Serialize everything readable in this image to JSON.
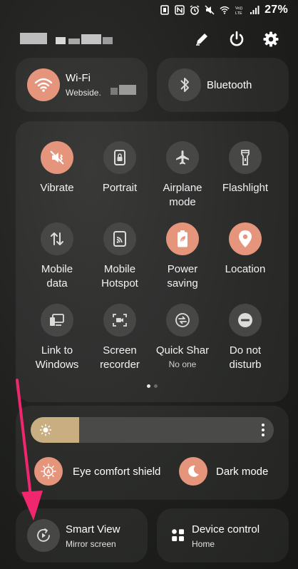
{
  "status": {
    "battery_pct": "27%",
    "network": "VoLTE LTE"
  },
  "header": {
    "icons": [
      "pencil-icon",
      "power-icon",
      "settings-gear-icon"
    ]
  },
  "wifi": {
    "title": "Wi-Fi",
    "subtitle": "Webside.",
    "state": "on"
  },
  "bluetooth": {
    "title": "Bluetooth",
    "state": "off"
  },
  "tiles": [
    {
      "label1": "Vibrate",
      "label2": "",
      "sub": "",
      "state": "on",
      "icon": "vibrate-icon"
    },
    {
      "label1": "Portrait",
      "label2": "",
      "sub": "",
      "state": "off",
      "icon": "portrait-lock-icon"
    },
    {
      "label1": "Airplane",
      "label2": "mode",
      "sub": "",
      "state": "off",
      "icon": "airplane-icon"
    },
    {
      "label1": "Flashlight",
      "label2": "",
      "sub": "",
      "state": "off",
      "icon": "flashlight-icon"
    },
    {
      "label1": "Mobile",
      "label2": "data",
      "sub": "",
      "state": "off",
      "icon": "mobile-data-icon"
    },
    {
      "label1": "Mobile",
      "label2": "Hotspot",
      "sub": "",
      "state": "off",
      "icon": "hotspot-icon"
    },
    {
      "label1": "Power",
      "label2": "saving",
      "sub": "",
      "state": "on",
      "icon": "power-saving-icon"
    },
    {
      "label1": "Location",
      "label2": "",
      "sub": "",
      "state": "on",
      "icon": "location-icon"
    },
    {
      "label1": "Link to",
      "label2": "Windows",
      "sub": "",
      "state": "off",
      "icon": "link-to-windows-icon"
    },
    {
      "label1": "Screen",
      "label2": "recorder",
      "sub": "",
      "state": "off",
      "icon": "screen-recorder-icon"
    },
    {
      "label1": "Quick Shar",
      "label2": "",
      "sub": "No one",
      "state": "off",
      "icon": "quick-share-icon"
    },
    {
      "label1": "Do not",
      "label2": "disturb",
      "sub": "",
      "state": "off",
      "icon": "do-not-disturb-icon"
    }
  ],
  "page_indicator": {
    "current": 1,
    "total": 2
  },
  "brightness": {
    "level": 0.2
  },
  "comfort": {
    "eye_comfort_label": "Eye comfort shield",
    "dark_mode_label": "Dark mode"
  },
  "smart_view": {
    "title": "Smart View",
    "subtitle": "Mirror screen"
  },
  "device_control": {
    "title": "Device control",
    "subtitle": "Home"
  },
  "colors": {
    "accent": "#e5957b",
    "annotation_arrow": "#f0266e"
  }
}
